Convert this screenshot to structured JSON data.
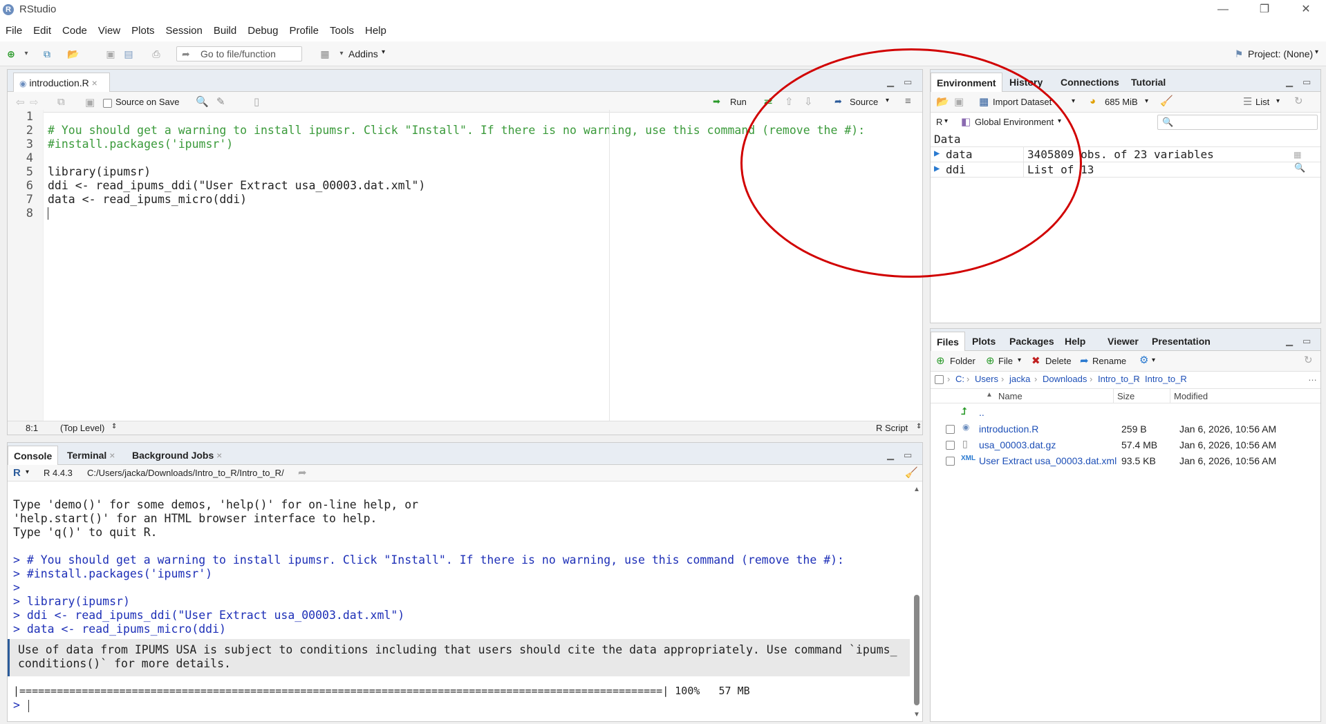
{
  "window": {
    "title": "RStudio",
    "min": "—",
    "restore": "❐",
    "close": "✕"
  },
  "menu": [
    "File",
    "Edit",
    "Code",
    "View",
    "Plots",
    "Session",
    "Build",
    "Debug",
    "Profile",
    "Tools",
    "Help"
  ],
  "toolbar": {
    "goto_placeholder": "Go to file/function",
    "addins": "Addins",
    "project": "Project: (None)"
  },
  "editor": {
    "tab_label": "introduction.R",
    "source_on_save": "Source on Save",
    "run": "Run",
    "source": "Source",
    "lines": [
      {
        "n": "1",
        "text": ""
      },
      {
        "n": "2",
        "text": "# You should get a warning to install ipumsr. Click \"Install\". If there is no warning, use this command (remove the #):"
      },
      {
        "n": "3",
        "text": "#install.packages('ipumsr')"
      },
      {
        "n": "4",
        "text": ""
      },
      {
        "n": "5",
        "text": "library(ipumsr)"
      },
      {
        "n": "6",
        "text": "ddi <- read_ipums_ddi(\"User Extract usa_00003.dat.xml\")"
      },
      {
        "n": "7",
        "text": "data <- read_ipums_micro(ddi)"
      },
      {
        "n": "8",
        "text": ""
      }
    ],
    "status_pos": "8:1",
    "status_scope": "(Top Level)",
    "status_type": "R Script"
  },
  "console": {
    "tabs": [
      "Console",
      "Terminal",
      "Background Jobs"
    ],
    "r_version": "R 4.4.3",
    "path": "C:/Users/jacka/Downloads/Intro_to_R/Intro_to_R/",
    "lines": [
      {
        "text": "Type 'demo()' for some demos, 'help()' for on-line help, or",
        "cls": ""
      },
      {
        "text": "'help.start()' for an HTML browser interface to help.",
        "cls": ""
      },
      {
        "text": "Type 'q()' to quit R.",
        "cls": ""
      },
      {
        "text": "",
        "cls": ""
      },
      {
        "text": "> # You should get a warning to install ipumsr. Click \"Install\". If there is no warning, use this command (remove the #):",
        "cls": "blue"
      },
      {
        "text": "> #install.packages('ipumsr')",
        "cls": "blue"
      },
      {
        "text": ">",
        "cls": "blue"
      },
      {
        "text": "> library(ipumsr)",
        "cls": "blue"
      },
      {
        "text": "> ddi <- read_ipums_ddi(\"User Extract usa_00003.dat.xml\")",
        "cls": "blue"
      },
      {
        "text": "> data <- read_ipums_micro(ddi)",
        "cls": "blue"
      }
    ],
    "message_1": "Use of data from IPUMS USA is subject to conditions including that users should cite the data appropriately. Use command `ipums_",
    "message_2": "conditions()` for more details.",
    "progress": "|=======================================================================================================| 100%   57 MB",
    "prompt": ">"
  },
  "environment": {
    "tabs": [
      "Environment",
      "History",
      "Connections",
      "Tutorial"
    ],
    "import_dataset": "Import Dataset",
    "memory": "685 MiB",
    "list_view": "List",
    "r_label": "R",
    "scope": "Global Environment",
    "section": "Data",
    "rows": [
      {
        "name": "data",
        "value": "3405809 obs. of 23 variables"
      },
      {
        "name": "ddi",
        "value": "List of  13"
      }
    ]
  },
  "files": {
    "tabs": [
      "Files",
      "Plots",
      "Packages",
      "Help",
      "Viewer",
      "Presentation"
    ],
    "folder": "Folder",
    "file": "File",
    "delete": "Delete",
    "rename": "Rename",
    "breadcrumbs": [
      "C:",
      "Users",
      "jacka",
      "Downloads",
      "Intro_to_R",
      "Intro_to_R"
    ],
    "columns": {
      "name": "Name",
      "size": "Size",
      "modified": "Modified"
    },
    "parent": "..",
    "rows": [
      {
        "name": "introduction.R",
        "size": "259 B",
        "modified": "Jan 6, 2026, 10:56 AM"
      },
      {
        "name": "usa_00003.dat.gz",
        "size": "57.4 MB",
        "modified": "Jan 6, 2026, 10:56 AM"
      },
      {
        "name": "User Extract usa_00003.dat.xml",
        "size": "93.5 KB",
        "modified": "Jan 6, 2026, 10:56 AM"
      }
    ]
  },
  "colors": {
    "annotation": "#d10000",
    "link": "#1d4fb7",
    "console_input": "#1d2fb7"
  }
}
